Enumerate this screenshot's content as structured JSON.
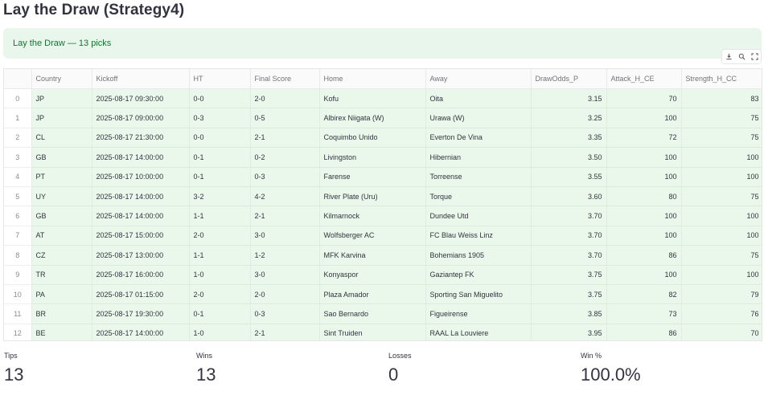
{
  "page": {
    "title": "Lay the Draw (Strategy4)",
    "banner": "Lay the Draw — 13 picks"
  },
  "toolbar": {
    "icons": [
      "download-icon",
      "search-icon",
      "fullscreen-icon"
    ]
  },
  "table": {
    "columns": [
      "",
      "Country",
      "Kickoff",
      "HT",
      "Final Score",
      "Home",
      "Away",
      "DrawOdds_P",
      "Attack_H_CE",
      "Strength_H_CC"
    ],
    "rows": [
      [
        "0",
        "JP",
        "2025-08-17 09:30:00",
        "0-0",
        "2-0",
        "Kofu",
        "Oita",
        "3.15",
        "70",
        "83"
      ],
      [
        "1",
        "JP",
        "2025-08-17 09:00:00",
        "0-3",
        "0-5",
        "Albirex Niigata (W)",
        "Urawa (W)",
        "3.25",
        "100",
        "75"
      ],
      [
        "2",
        "CL",
        "2025-08-17 21:30:00",
        "0-0",
        "2-1",
        "Coquimbo Unido",
        "Everton De Vina",
        "3.35",
        "72",
        "75"
      ],
      [
        "3",
        "GB",
        "2025-08-17 14:00:00",
        "0-1",
        "0-2",
        "Livingston",
        "Hibernian",
        "3.50",
        "100",
        "100"
      ],
      [
        "4",
        "PT",
        "2025-08-17 10:00:00",
        "0-1",
        "0-3",
        "Farense",
        "Torreense",
        "3.55",
        "100",
        "100"
      ],
      [
        "5",
        "UY",
        "2025-08-17 14:00:00",
        "3-2",
        "4-2",
        "River Plate (Uru)",
        "Torque",
        "3.60",
        "80",
        "75"
      ],
      [
        "6",
        "GB",
        "2025-08-17 14:00:00",
        "1-1",
        "2-1",
        "Kilmarnock",
        "Dundee Utd",
        "3.70",
        "100",
        "100"
      ],
      [
        "7",
        "AT",
        "2025-08-17 15:00:00",
        "2-0",
        "3-0",
        "Wolfsberger AC",
        "FC Blau Weiss Linz",
        "3.70",
        "100",
        "100"
      ],
      [
        "8",
        "CZ",
        "2025-08-17 13:00:00",
        "1-1",
        "1-2",
        "MFK Karvina",
        "Bohemians 1905",
        "3.70",
        "86",
        "75"
      ],
      [
        "9",
        "TR",
        "2025-08-17 16:00:00",
        "1-0",
        "3-0",
        "Konyaspor",
        "Gaziantep FK",
        "3.75",
        "100",
        "100"
      ],
      [
        "10",
        "PA",
        "2025-08-17 01:15:00",
        "2-0",
        "2-0",
        "Plaza Amador",
        "Sporting San Miguelito",
        "3.75",
        "82",
        "79"
      ],
      [
        "11",
        "BR",
        "2025-08-17 19:30:00",
        "0-1",
        "0-3",
        "Sao Bernardo",
        "Figueirense",
        "3.85",
        "73",
        "76"
      ],
      [
        "12",
        "BE",
        "2025-08-17 14:00:00",
        "1-0",
        "2-1",
        "Sint Truiden",
        "RAAL La Louviere",
        "3.95",
        "86",
        "70"
      ]
    ]
  },
  "metrics": [
    {
      "label": "Tips",
      "value": "13"
    },
    {
      "label": "Wins",
      "value": "13"
    },
    {
      "label": "Losses",
      "value": "0"
    },
    {
      "label": "Win %",
      "value": "100.0%"
    }
  ],
  "colors": {
    "banner_bg": "#e8f6ec",
    "banner_text": "#177233",
    "row_highlight": "#e9f8ea"
  }
}
